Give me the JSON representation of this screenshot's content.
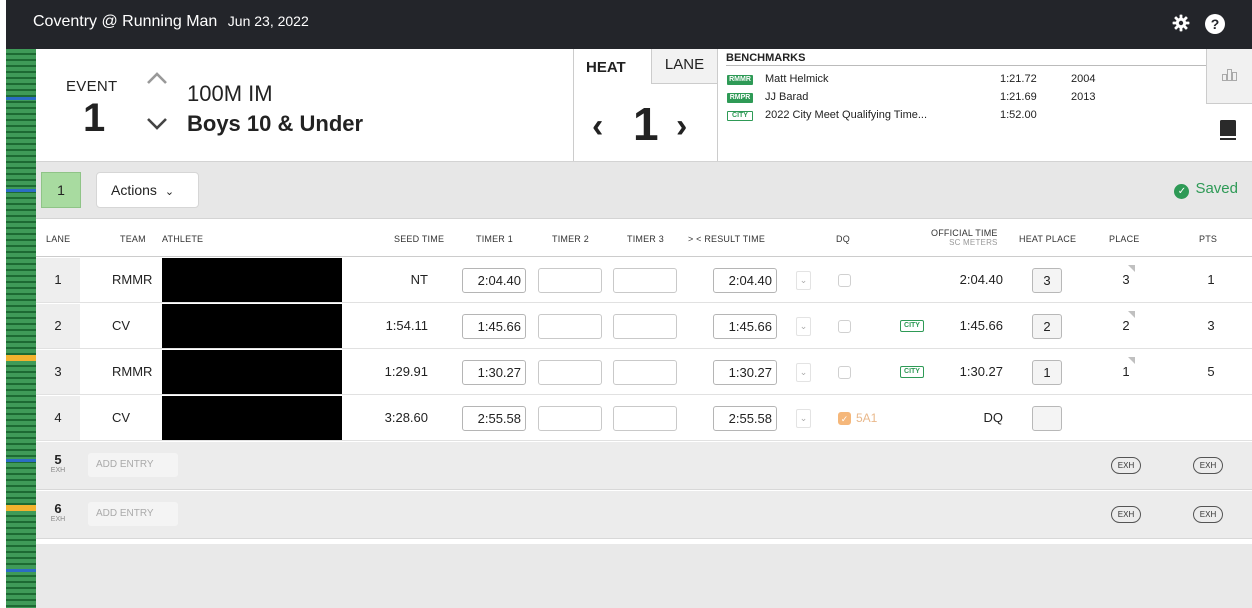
{
  "header": {
    "title": "Coventry @ Running Man",
    "date": "Jun 23, 2022",
    "settings_icon": "gear-icon",
    "help_icon": "help-icon",
    "help_glyph": "?"
  },
  "event": {
    "label": "EVENT",
    "number": "1",
    "name": "100M IM",
    "group": "Boys 10 & Under"
  },
  "heat": {
    "tab_heat": "HEAT",
    "tab_lane": "LANE",
    "number": "1"
  },
  "benchmarks": {
    "title": "BENCHMARKS",
    "items": [
      {
        "badge": "RMMR",
        "name": "Matt Helmick",
        "time": "1:21.72",
        "year": "2004"
      },
      {
        "badge": "RMPR",
        "name": "JJ Barad",
        "time": "1:21.69",
        "year": "2013"
      },
      {
        "badge": "CITY",
        "name": "2022 City Meet Qualifying Time...",
        "time": "1:52.00",
        "year": ""
      }
    ]
  },
  "toolbar": {
    "heat_chip": "1",
    "actions_label": "Actions",
    "saved_label": "Saved"
  },
  "columns": {
    "lane": "LANE",
    "team": "TEAM",
    "athlete": "ATHLETE",
    "seed": "SEED TIME",
    "timer1": "TIMER 1",
    "timer2": "TIMER 2",
    "timer3": "TIMER 3",
    "result": "> < RESULT TIME",
    "dq": "DQ",
    "official": "OFFICIAL TIME",
    "official_sub": "SC METERS",
    "heat_place": "HEAT PLACE",
    "place": "PLACE",
    "pts": "PTS"
  },
  "rows": [
    {
      "lane": "1",
      "team": "RMMR",
      "seed": "NT",
      "timer1": "2:04.40",
      "result": "2:04.40",
      "official": "2:04.40",
      "heat_place": "3",
      "place": "3",
      "pts": "1"
    },
    {
      "lane": "2",
      "team": "CV",
      "seed": "1:54.11",
      "timer1": "1:45.66",
      "result": "1:45.66",
      "city": "CITY",
      "official": "1:45.66",
      "heat_place": "2",
      "place": "2",
      "pts": "3"
    },
    {
      "lane": "3",
      "team": "RMMR",
      "seed": "1:29.91",
      "timer1": "1:30.27",
      "result": "1:30.27",
      "city": "CITY",
      "official": "1:30.27",
      "heat_place": "1",
      "place": "1",
      "pts": "5"
    },
    {
      "lane": "4",
      "team": "CV",
      "seed": "3:28.60",
      "timer1": "2:55.58",
      "result": "2:55.58",
      "dq_code": "5A1",
      "official": "DQ",
      "heat_place": "",
      "place": "",
      "pts": ""
    }
  ],
  "empty_rows": [
    {
      "lane": "5",
      "sub": "EXH",
      "add_label": "ADD ENTRY",
      "exh": "EXH"
    },
    {
      "lane": "6",
      "sub": "EXH",
      "add_label": "ADD ENTRY",
      "exh": "EXH"
    }
  ],
  "colors": {
    "topbar": "#23252a",
    "accent_green": "#2e9a56",
    "heat_chip": "#a8dba0",
    "dq_orange": "#f5b77a",
    "strip_marker_yellow": "#f2b22e",
    "strip_marker_blue": "#2b6cc4"
  }
}
